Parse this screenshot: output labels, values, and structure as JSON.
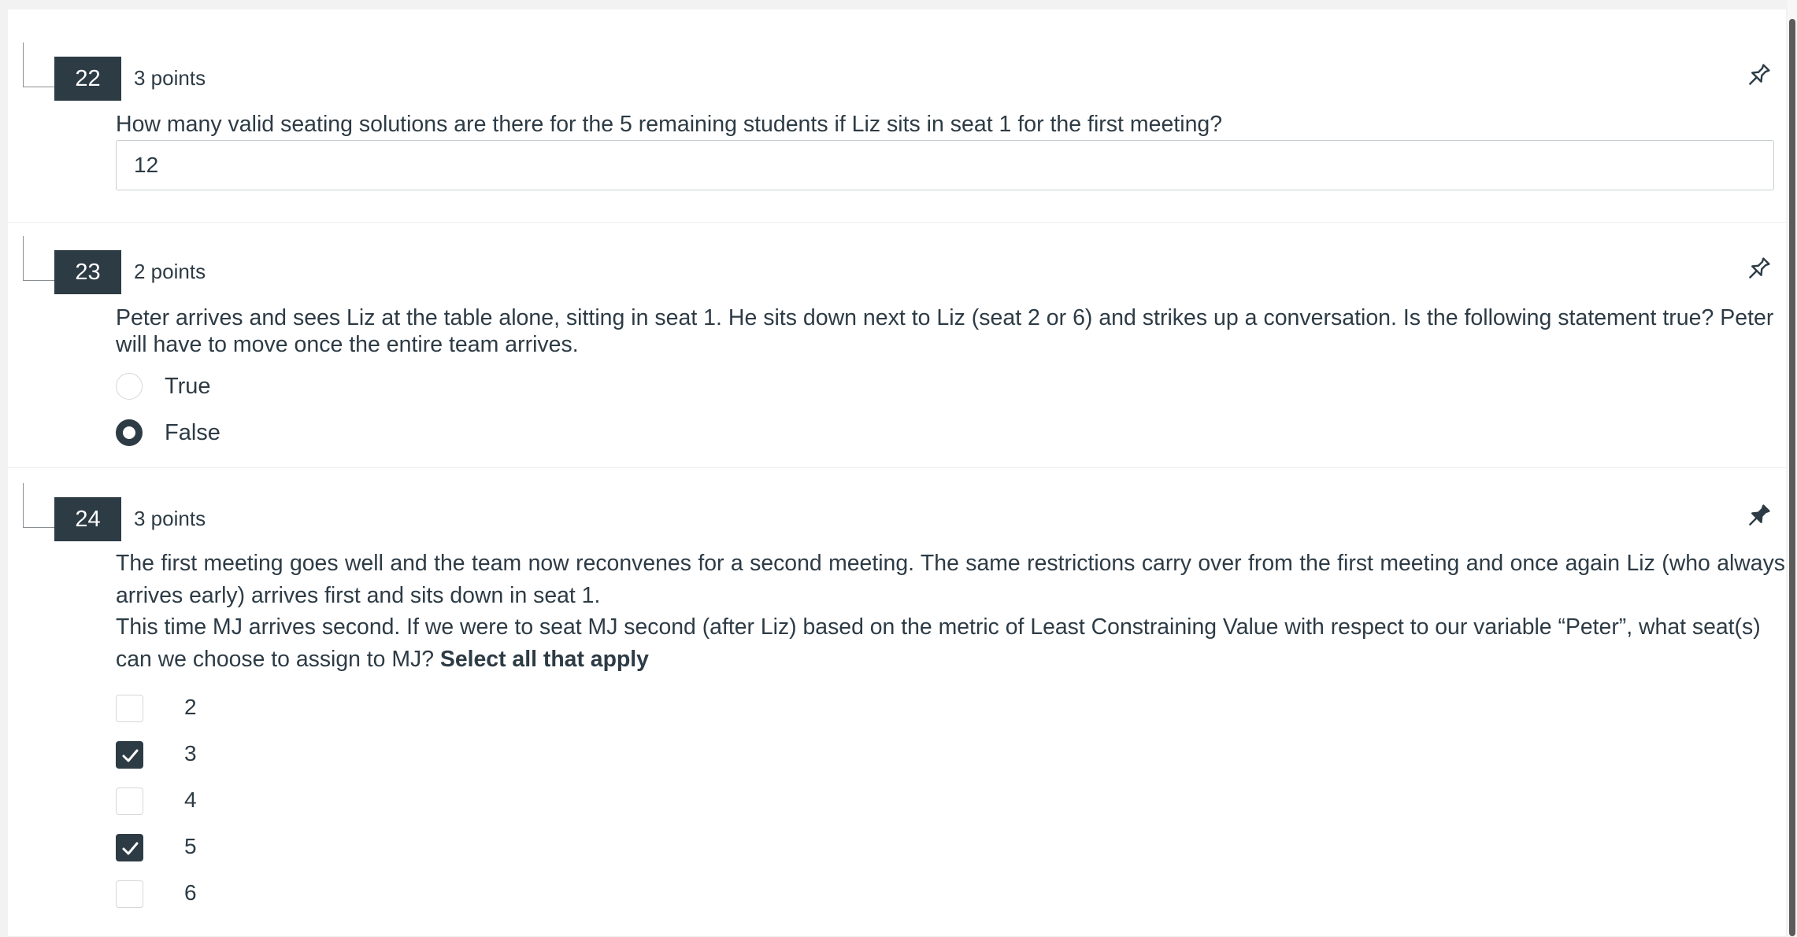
{
  "questions": [
    {
      "number": "22",
      "points": "3 points",
      "text": "How many valid seating solutions are there for the 5 remaining students if Liz sits in seat 1 for the first meeting?",
      "answer_value": "12",
      "pin_icon": "pin-outline-icon"
    },
    {
      "number": "23",
      "points": "2 points",
      "text": "Peter arrives and sees Liz at the table alone, sitting in seat 1. He sits down next to Liz (seat 2 or 6) and strikes up a conversation. Is the following statement true? Peter will have to move once the entire team arrives.",
      "options": [
        {
          "label": "True",
          "selected": false
        },
        {
          "label": "False",
          "selected": true
        }
      ],
      "pin_icon": "pin-outline-icon"
    },
    {
      "number": "24",
      "points": "3 points",
      "paragraph1": "The first meeting goes well and the team now reconvenes for a second meeting. The same restrictions carry over from the first meeting and once again Liz (who always arrives early) arrives first and sits down in seat 1.",
      "paragraph2": "This time MJ arrives second. If we were to seat MJ second (after Liz) based on the metric of Least Constraining Value with respect to our variable “Peter”, what seat(s) can we choose to assign to MJ?",
      "paragraph2_bold": "Select all that apply",
      "options": [
        {
          "label": "2",
          "checked": false
        },
        {
          "label": "3",
          "checked": true
        },
        {
          "label": "4",
          "checked": false
        },
        {
          "label": "5",
          "checked": true
        },
        {
          "label": "6",
          "checked": false
        }
      ],
      "pin_icon": "pin-filled-icon"
    }
  ],
  "colors": {
    "accent": "#2d3b45",
    "border": "#c7cdd1",
    "page_background": "#f2f2f2"
  }
}
